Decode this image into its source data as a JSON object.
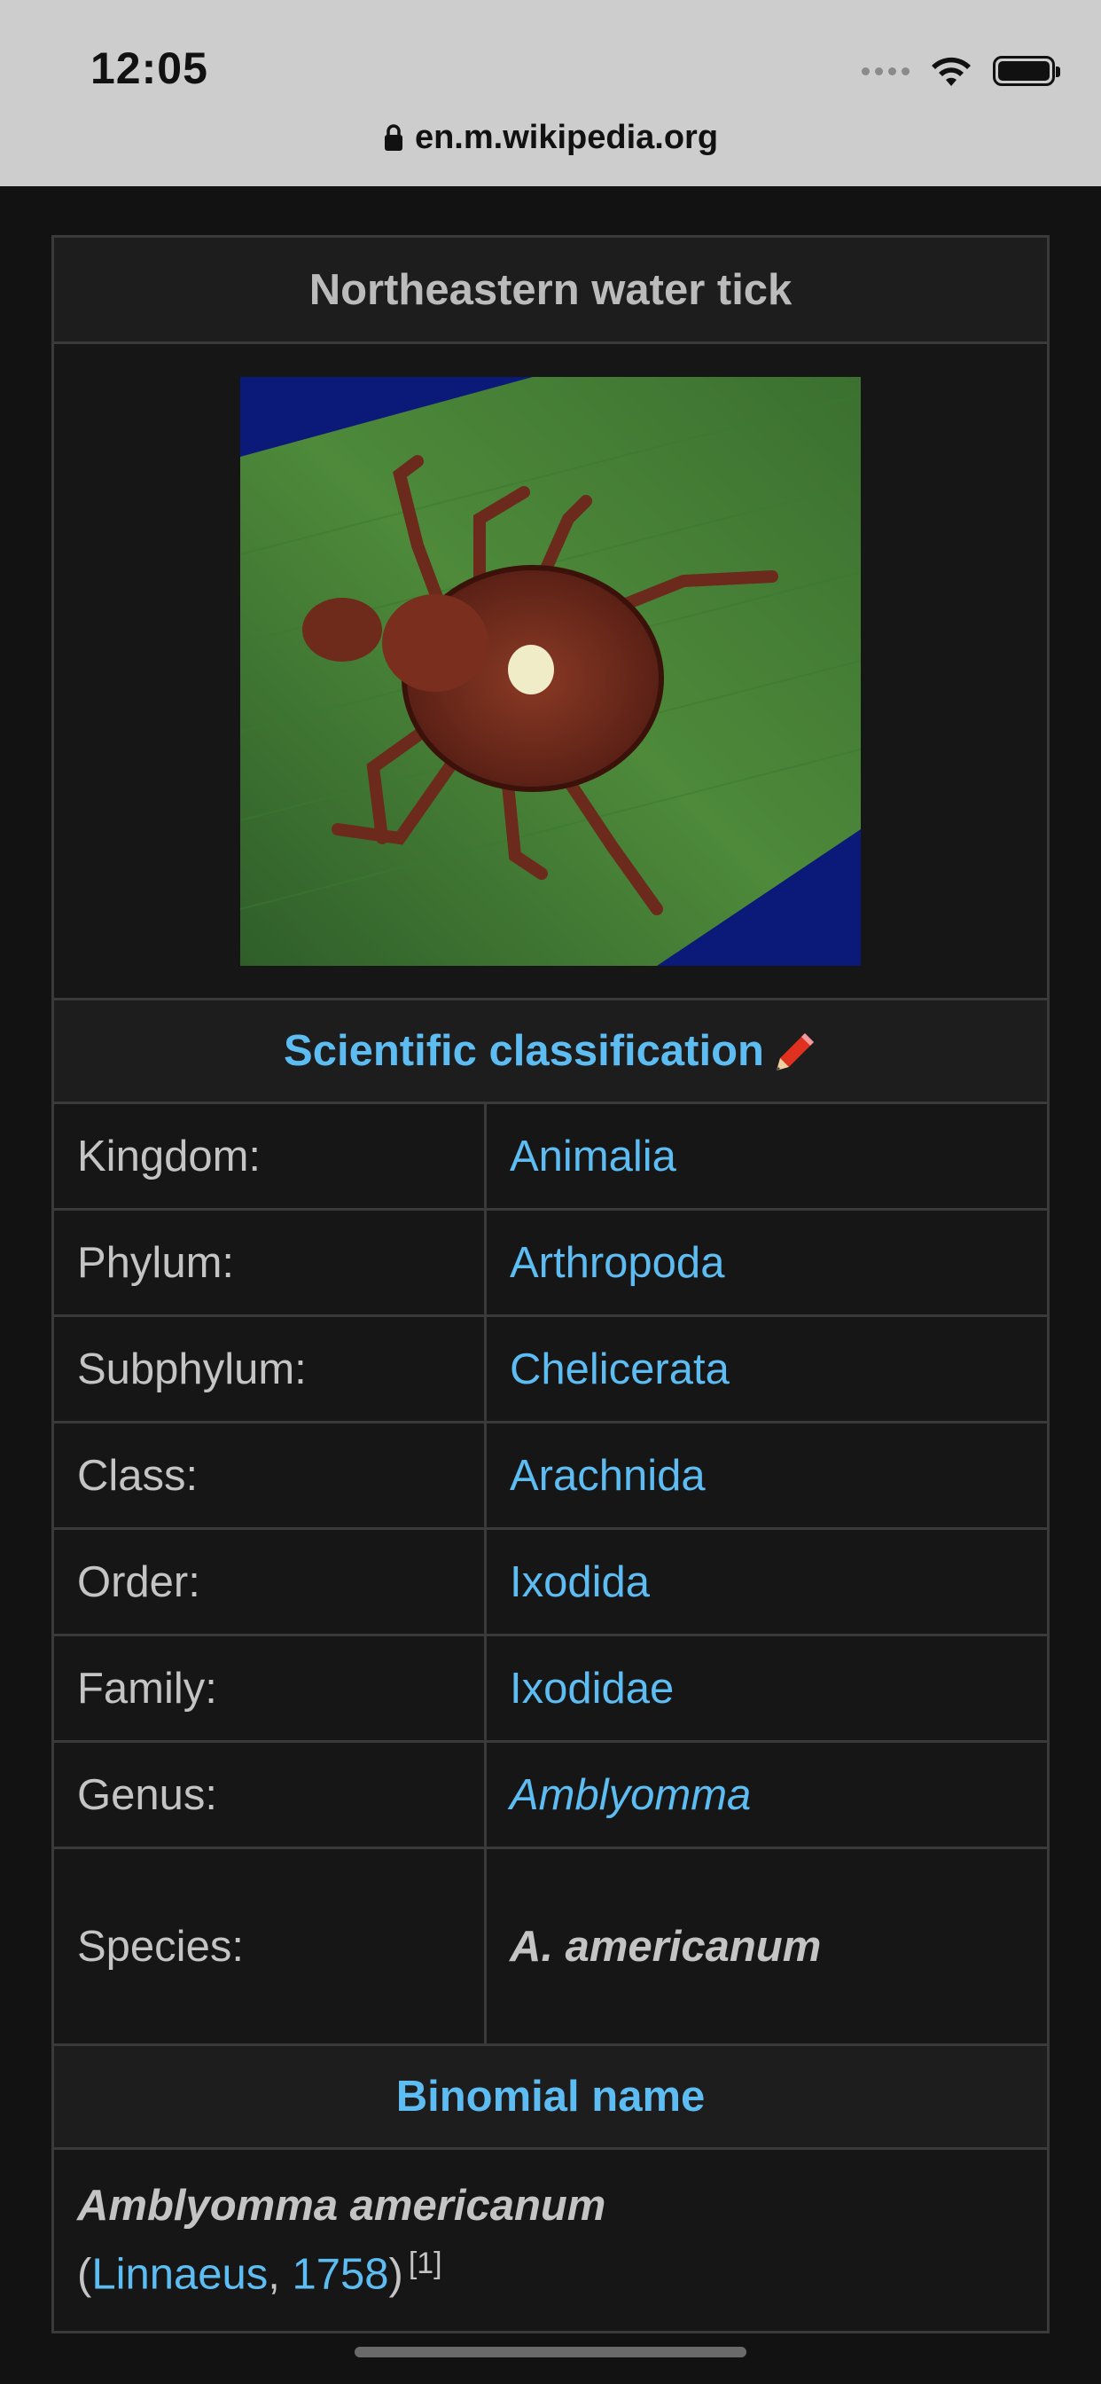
{
  "status_bar": {
    "time": "12:05"
  },
  "browser": {
    "url": "en.m.wikipedia.org"
  },
  "infobox": {
    "title": "Northeastern water tick",
    "classification_header": "Scientific classification",
    "ranks": [
      {
        "label": "Kingdom:",
        "value": "Animalia"
      },
      {
        "label": "Phylum:",
        "value": "Arthropoda"
      },
      {
        "label": "Subphylum:",
        "value": "Chelicerata"
      },
      {
        "label": "Class:",
        "value": "Arachnida"
      },
      {
        "label": "Order:",
        "value": "Ixodida"
      },
      {
        "label": "Family:",
        "value": "Ixodidae"
      },
      {
        "label": "Genus:",
        "value": "Amblyomma"
      },
      {
        "label": "Species:",
        "value": "A. americanum"
      }
    ],
    "binomial_header": "Binomial name",
    "binomial_name": "Amblyomma americanum",
    "authority_open": "(",
    "authority_author": "Linnaeus",
    "authority_sep": ", ",
    "authority_year": "1758",
    "authority_close": ")",
    "reference": "[1]"
  },
  "colors": {
    "link": "#5dbdf2",
    "background": "#121212"
  }
}
